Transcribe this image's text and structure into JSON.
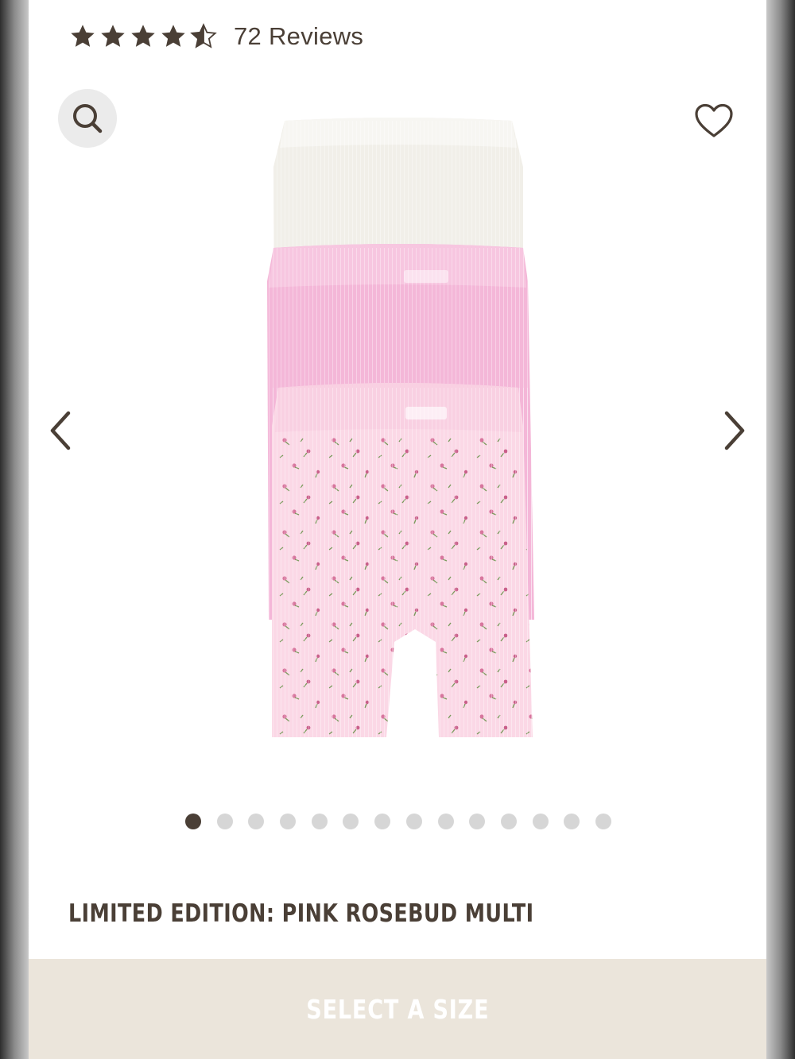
{
  "rating": {
    "stars": 4.5,
    "reviews_label": "72 Reviews"
  },
  "header": {
    "search_icon": "search-icon",
    "wishlist_icon": "heart-icon"
  },
  "carousel": {
    "prev_icon": "chevron-left-icon",
    "next_icon": "chevron-right-icon",
    "total_slides": 14,
    "active_slide": 1
  },
  "product": {
    "title": "LIMITED EDITION: PINK ROSEBUD MULTI"
  },
  "cta": {
    "label": "SELECT A SIZE"
  },
  "colors": {
    "text_brown": "#4a3f36",
    "cta_background": "#ebe5db",
    "dot_inactive": "#d6d6d6",
    "search_bg": "#ebebeb"
  }
}
